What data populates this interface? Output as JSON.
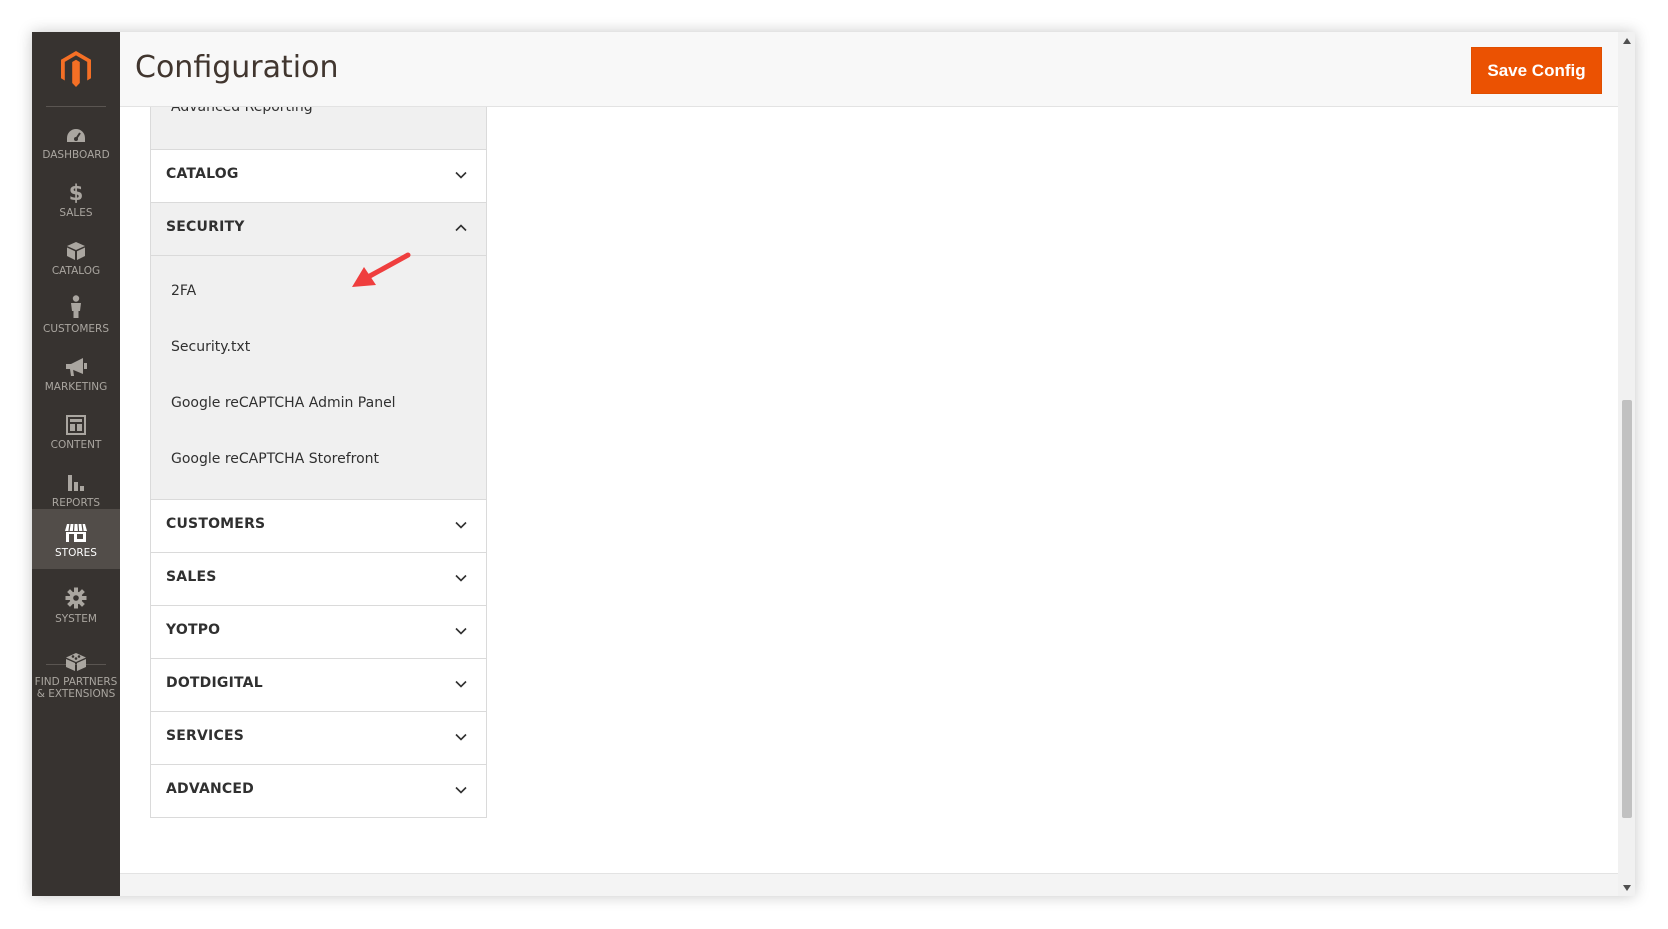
{
  "nav": {
    "items": [
      {
        "id": "dashboard",
        "label": "DASHBOARD",
        "icon": "dashboard-gauge-icon",
        "active": false
      },
      {
        "id": "sales",
        "label": "SALES",
        "icon": "dollar-icon",
        "active": false
      },
      {
        "id": "catalog",
        "label": "CATALOG",
        "icon": "box-icon",
        "active": false
      },
      {
        "id": "customers",
        "label": "CUSTOMERS",
        "icon": "person-icon",
        "active": false
      },
      {
        "id": "marketing",
        "label": "MARKETING",
        "icon": "megaphone-icon",
        "active": false
      },
      {
        "id": "content",
        "label": "CONTENT",
        "icon": "layout-icon",
        "active": false
      },
      {
        "id": "reports",
        "label": "REPORTS",
        "icon": "bar-chart-icon",
        "active": false
      },
      {
        "id": "stores",
        "label": "STORES",
        "icon": "storefront-icon",
        "active": true
      },
      {
        "id": "system",
        "label": "SYSTEM",
        "icon": "gear-icon",
        "active": false
      },
      {
        "id": "partners",
        "label": "FIND PARTNERS\n& EXTENSIONS",
        "icon": "blocks-icon",
        "active": false
      }
    ]
  },
  "header": {
    "title": "Configuration",
    "save_label": "Save Config"
  },
  "config_tabs": {
    "cut_item": "Advanced Reporting",
    "catalog": "CATALOG",
    "security": {
      "title": "SECURITY",
      "expanded": true,
      "items": [
        "2FA",
        "Security.txt",
        "Google reCAPTCHA Admin Panel",
        "Google reCAPTCHA Storefront"
      ]
    },
    "customers": "CUSTOMERS",
    "sales": "SALES",
    "yotpo": "YOTPO",
    "dotdigital": "DOTDIGITAL",
    "services": "SERVICES",
    "advanced": "ADVANCED"
  },
  "colors": {
    "accent": "#eb5202",
    "nav_bg": "#373330",
    "nav_active": "#524d49",
    "annotation": "#ef3e3e"
  }
}
